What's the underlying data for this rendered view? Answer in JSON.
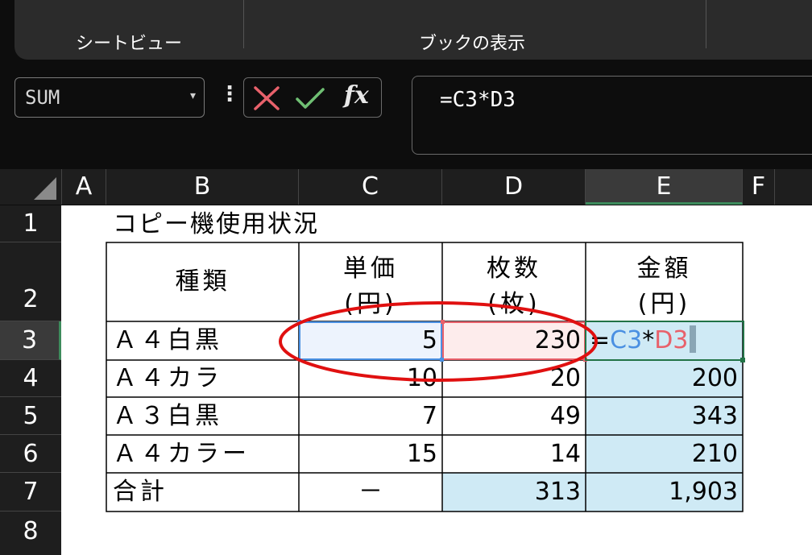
{
  "ribbon": {
    "group1": "シートビュー",
    "group2": "ブックの表示"
  },
  "formula_bar": {
    "name_box": "SUM",
    "fx": "fx",
    "formula": "=C3*D3"
  },
  "columns": [
    "A",
    "B",
    "C",
    "D",
    "E",
    "F"
  ],
  "rows": [
    "1",
    "2",
    "3",
    "4",
    "5",
    "6",
    "7",
    "8"
  ],
  "sheet": {
    "title": "コピー機使用状況",
    "headers": {
      "type": "種類",
      "unit_price_1": "単価",
      "unit_price_2": "(円)",
      "count_1": "枚数",
      "count_2": "(枚)",
      "amount_1": "金額",
      "amount_2": "(円)"
    },
    "data": [
      {
        "type": "Ａ４白黒",
        "price": "5",
        "count": "230"
      },
      {
        "type": "Ａ４カラ",
        "price": "10",
        "count": "20",
        "amount": "200"
      },
      {
        "type": "Ａ３白黒",
        "price": "7",
        "count": "49",
        "amount": "343"
      },
      {
        "type": "Ａ４カラー",
        "price": "15",
        "count": "14",
        "amount": "210"
      }
    ],
    "total": {
      "label": "合計",
      "price": "－",
      "count": "313",
      "amount": "1,903"
    },
    "editing": {
      "eq": "=",
      "ref1": "C3",
      "op": "*",
      "ref2": "D3"
    }
  },
  "colors": {
    "ref1": "#4a90e2",
    "ref2": "#e8616b",
    "highlight": "#cfeaf5",
    "annotation": "#e01010"
  }
}
